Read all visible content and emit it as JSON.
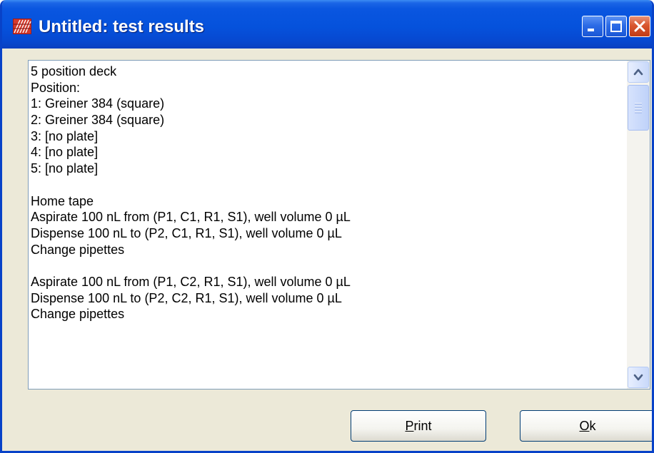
{
  "window": {
    "title": "Untitled: test results",
    "icon": "app-grid-icon"
  },
  "titlebar_buttons": [
    "minimize-icon",
    "maximize-icon",
    "close-icon"
  ],
  "results": {
    "lines": [
      "5 position deck",
      "Position:",
      "1: Greiner 384 (square)",
      "2: Greiner 384 (square)",
      "3: [no plate]",
      "4: [no plate]",
      "5: [no plate]",
      "",
      "Home tape",
      "Aspirate 100 nL from (P1, C1, R1, S1), well volume 0 µL",
      "Dispense 100 nL to (P2, C1, R1, S1), well volume 0 µL",
      "Change pipettes",
      "",
      "Aspirate 100 nL from (P1, C2, R1, S1), well volume 0 µL",
      "Dispense 100 nL to (P2, C2, R1, S1), well volume 0 µL",
      "Change pipettes"
    ]
  },
  "buttons": {
    "print": {
      "mnemonic": "P",
      "rest": "rint"
    },
    "ok": {
      "mnemonic": "O",
      "rest": "k"
    }
  },
  "colors": {
    "titlebar": "#0552DC",
    "window_face": "#ECE9D8",
    "close_button": "#D9562E",
    "scrollbar": "#C9D9FA"
  }
}
